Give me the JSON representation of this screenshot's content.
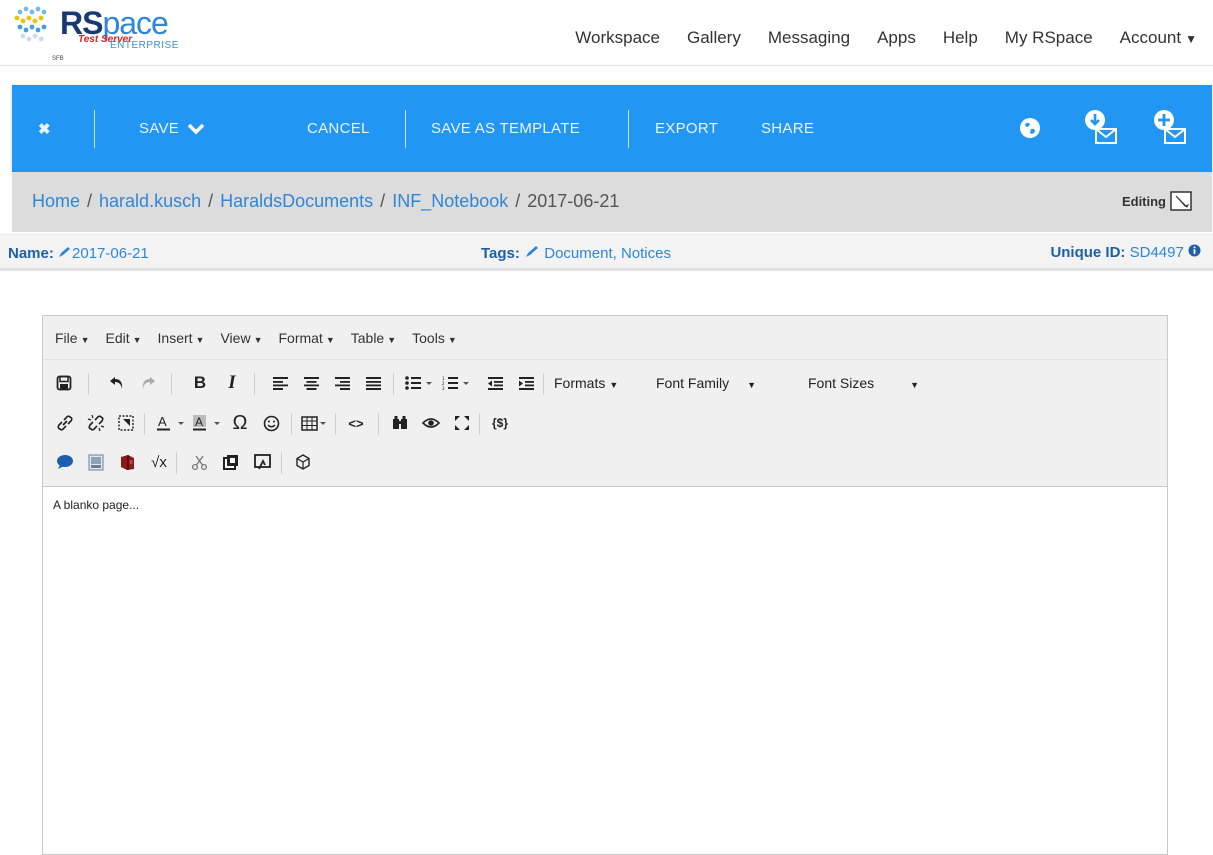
{
  "header": {
    "logo": {
      "brand_bold": "RS",
      "brand_rest": "pace",
      "test_label": "Test Server",
      "edition": "ENTERPRISE",
      "org": "SFB"
    },
    "nav": [
      {
        "label": "Workspace"
      },
      {
        "label": "Gallery"
      },
      {
        "label": "Messaging"
      },
      {
        "label": "Apps"
      },
      {
        "label": "Help"
      },
      {
        "label": "My RSpace"
      },
      {
        "label": "Account"
      }
    ]
  },
  "action_bar": {
    "save_label": "SAVE",
    "cancel_label": "CANCEL",
    "save_template_label": "SAVE AS TEMPLATE",
    "export_label": "EXPORT",
    "share_label": "SHARE",
    "accent_color": "#2196f3"
  },
  "breadcrumb": {
    "items": [
      "Home",
      "harald.kusch",
      "HaraldsDocuments",
      "INF_Notebook"
    ],
    "current": "2017-06-21",
    "separator": "/"
  },
  "status": {
    "editing_label": "Editing"
  },
  "info": {
    "name_label": "Name:",
    "name_value": "2017-06-21",
    "tags_label": "Tags:",
    "tags_value": "Document, Notices",
    "uid_label": "Unique ID:",
    "uid_value": "SD4497"
  },
  "editor": {
    "menus": [
      "File",
      "Edit",
      "Insert",
      "View",
      "Format",
      "Table",
      "Tools"
    ],
    "dropdowns": {
      "formats": "Formats",
      "font_family": "Font Family",
      "font_sizes": "Font Sizes"
    },
    "content": "A blanko page..."
  }
}
